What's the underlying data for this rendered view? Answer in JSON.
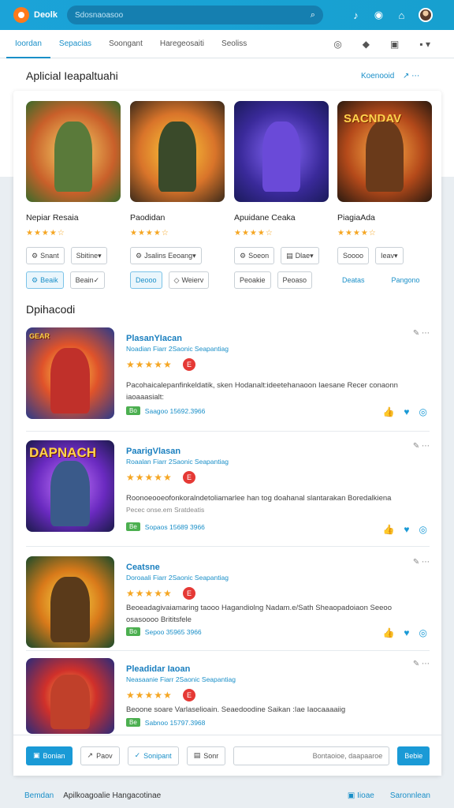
{
  "topbar": {
    "app_name": "Deolk",
    "search_placeholder": "Sdosnaoasoo"
  },
  "tabs": [
    "Ioordan",
    "Sepacias",
    "Soongant",
    "Haregeosaiti",
    "Seoliss"
  ],
  "section": {
    "title": "Aplicial Ieapaltuahi",
    "link": "Koenooid"
  },
  "featured": [
    {
      "name": "Nepiar Resaia",
      "rating": 4,
      "buttons": [
        "Snant",
        "Sbitine",
        "Beaik",
        "Beain"
      ]
    },
    {
      "name": "Paodidan",
      "rating": 4,
      "buttons": [
        "Jsalins Eeoang",
        "Deooo",
        "Weierv"
      ]
    },
    {
      "name": "Apuidane Ceaka",
      "rating": 4,
      "buttons": [
        "Soeon",
        "Dlae",
        "Peoakie",
        "Peoaso"
      ]
    },
    {
      "name": "PiagiaAda",
      "rating": 4,
      "buttons": [
        "Soooo",
        "Ieav",
        "Deatas",
        "Pangono"
      ]
    }
  ],
  "list_title": "Dpihacodi",
  "list": [
    {
      "name": "PlasanYIacan",
      "sub": "Noadian Fiarr 2Saonic Seapantiag",
      "rating": 5,
      "desc": "Pacohaicalepanfinkeldatik, sken Hodanalt:ideetehanaoon Iaesane Recer conaonn iaoaaasialt:",
      "tag": "Bo",
      "meta": "Saagoo   15692.3966",
      "thumb_text": "GEAR"
    },
    {
      "name": "PaarigVlasan",
      "sub": "Roaalan Fiarr 2Saonic Seapantiag",
      "rating": 5,
      "desc": "Roonoeooeofonkoralndetoliamarlee han tog doahanal slantarakan Boredalkiena",
      "desc2": "Pecec onse.em Sratdeatis",
      "tag": "Be",
      "meta": "Sopaos   15689 3966",
      "thumb_text": "DAPNACH"
    },
    {
      "name": "Ceatsne",
      "sub": "Doroaali Fiarr 2Saonic Seapantiag",
      "rating": 5,
      "desc": "Beoeadagivaiamaring taooo Hagandiolng Nadam.e/Sath Sheaopadoiaon Seeoo osasoooo Brititsfele",
      "tag": "Bo",
      "meta": "Sepoo   35965 3966",
      "thumb_text": ""
    },
    {
      "name": "Pleadidar Iaoan",
      "sub": "Neasaanie Fiarr 2Saonic Seapantiag",
      "rating": 5,
      "desc": "Beoone soare Varlaselioain. Seaedoodine Saikan :Iae Iaocaaaaiig",
      "tag": "Be",
      "meta": "Sabnoo   15797.3968",
      "thumb_text": ""
    }
  ],
  "bottom": {
    "b1": "Bonian",
    "b2": "Paov",
    "b3": "Sonipant",
    "b4": "Sonr",
    "input_placeholder": "Bontaoioe, daapaaroe",
    "submit": "Bebie"
  },
  "footer": {
    "left": "Bemdan",
    "mid": "Apilkoagoalie Hangacotinae",
    "r1": "Iioae",
    "r2": "Saronnlean"
  }
}
